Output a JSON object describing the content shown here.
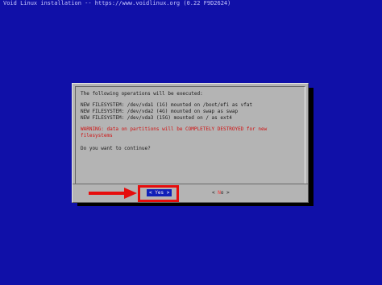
{
  "backtitle": "Void Linux installation -- https://www.voidlinux.org (0.22 F9D2624)",
  "dialog": {
    "lines": [
      "The following operations will be executed:",
      "NEW FILESYSTEM: /dev/vda1 (1G) mounted on /boot/efi as vfat",
      "NEW FILESYSTEM: /dev/vda2 (4G) mounted on swap as swap",
      "NEW FILESYSTEM: /dev/vda3 (15G) mounted on / as ext4",
      "WARNING: data on partitions will be COMPLETELY DESTROYED for new",
      "filesystems",
      "Do you want to continue?"
    ],
    "yes": {
      "open": "<",
      "hot": "Y",
      "rest": "es",
      "close": ">"
    },
    "no": {
      "open": "<",
      "hot": "N",
      "rest": "o",
      "close": ">"
    }
  },
  "colors": {
    "background": "#1010a8",
    "dialog": "#b4b4b4",
    "warning": "#d01010",
    "selected_button": "#1020b8",
    "annotation": "#e60d0d"
  },
  "icons": {
    "annotation_arrow": "arrow-right-icon"
  }
}
